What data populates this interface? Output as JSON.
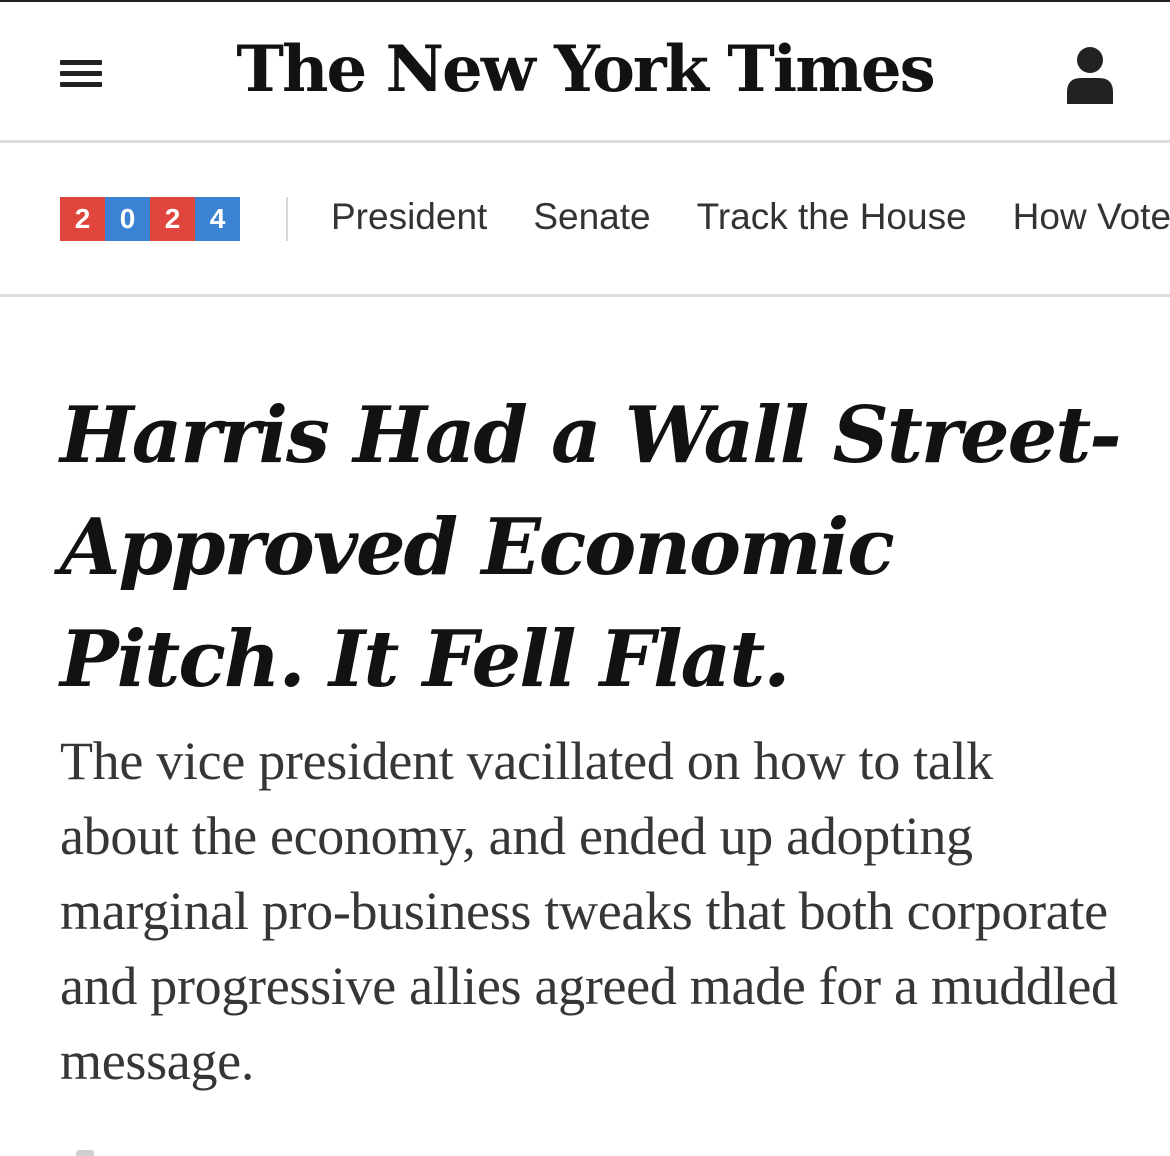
{
  "masthead": {
    "logo_text": "The New York Times",
    "menu_icon": "hamburger-menu-icon",
    "account_icon": "person-icon"
  },
  "election_nav": {
    "badge_digits": [
      "2",
      "0",
      "2",
      "4"
    ],
    "badge_colors": [
      "#e0463e",
      "#3b82d2",
      "#e0463e",
      "#3b82d2"
    ],
    "items": [
      "President",
      "Senate",
      "Track the House",
      "How Voters"
    ]
  },
  "article": {
    "headline": "Harris Had a Wall Street-Approved Economic Pitch. It Fell Flat.",
    "summary": "The vice president vacillated on how to talk about the economy, and ended up adopting marginal pro-business tweaks that both corporate and progressive allies agreed made for a muddled message."
  }
}
